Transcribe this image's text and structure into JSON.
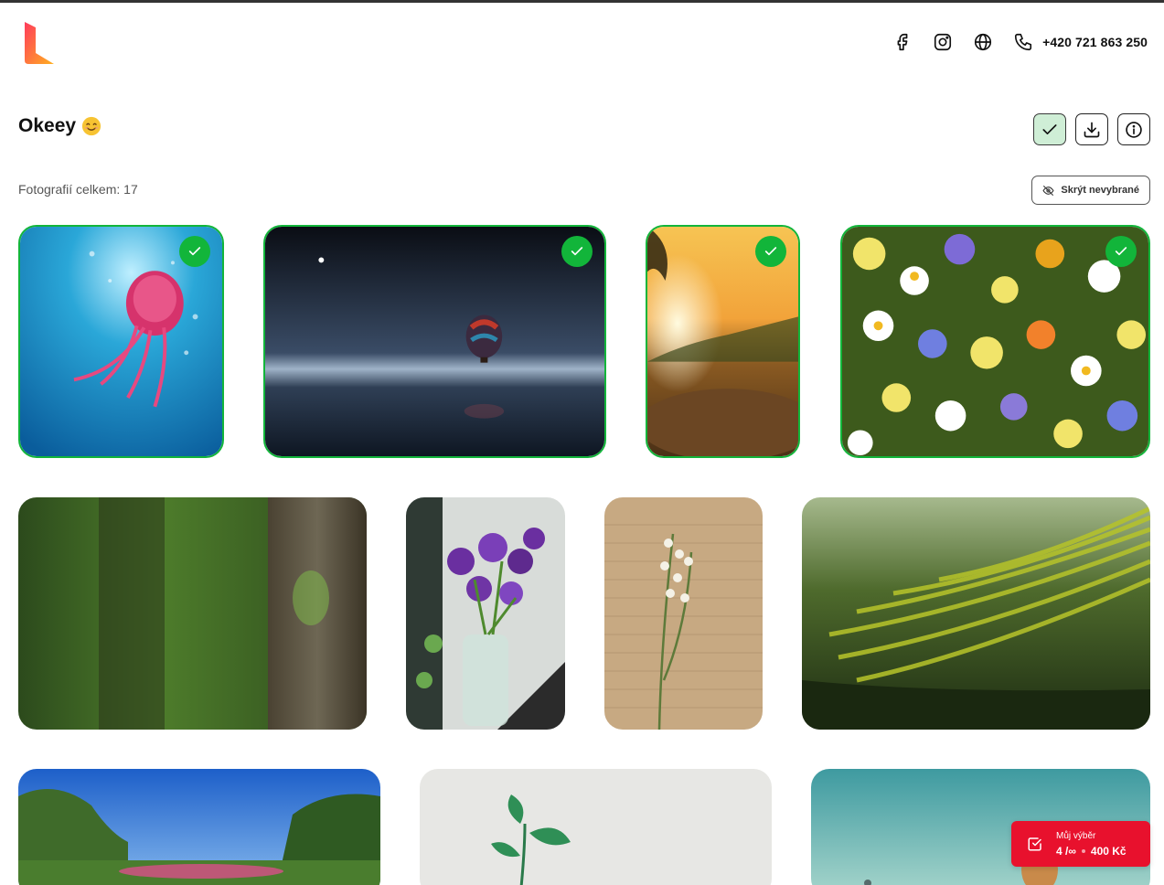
{
  "header": {
    "phone": "+420 721 863 250",
    "icons": [
      "facebook-icon",
      "instagram-icon",
      "globe-icon",
      "phone-icon"
    ]
  },
  "gallery": {
    "title": "Okeey",
    "title_emoji": "smiling-face-emoji",
    "photo_count_label": "Fotografií celkem: 17",
    "hide_unselected_label": "Skrýt nevybrané"
  },
  "actions": [
    "check-icon",
    "download-icon",
    "info-icon"
  ],
  "photos": [
    {
      "subject": "jellyfish underwater",
      "selected": true
    },
    {
      "subject": "hot air balloon over sea at night",
      "selected": true
    },
    {
      "subject": "sunset over rocks",
      "selected": true
    },
    {
      "subject": "colorful flowers",
      "selected": true
    },
    {
      "subject": "tree trunk in forest",
      "selected": false
    },
    {
      "subject": "purple flowers in vase",
      "selected": false
    },
    {
      "subject": "lily of the valley on paper",
      "selected": false
    },
    {
      "subject": "rice terraces",
      "selected": false
    },
    {
      "subject": "park with trees",
      "selected": false
    },
    {
      "subject": "green plant sprout",
      "selected": false
    },
    {
      "subject": "hot air balloons",
      "selected": false
    }
  ],
  "selection": {
    "label": "Můj výběr",
    "count": "4 /∞",
    "price": "400 Kč"
  },
  "colors": {
    "selected_border": "#12b53a",
    "selection_widget": "#e8112d",
    "active_button_bg": "#cfeed6"
  }
}
